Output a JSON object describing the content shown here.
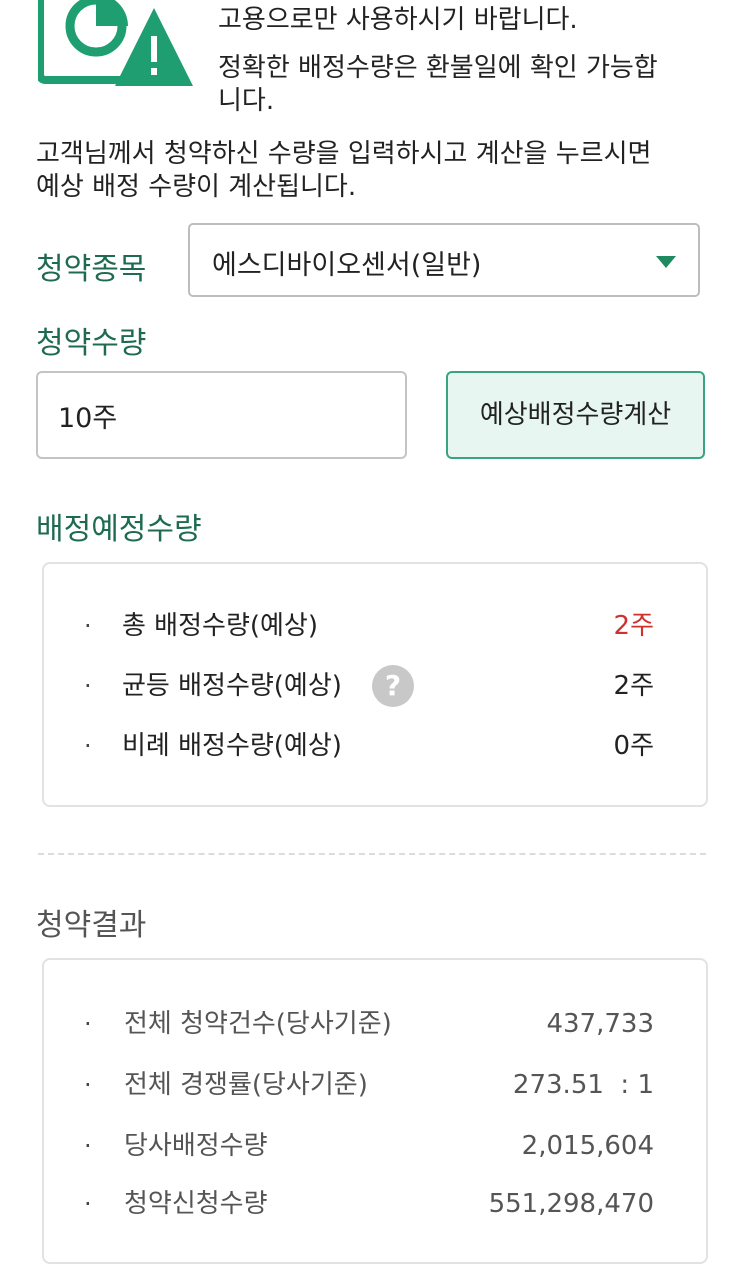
{
  "notice": {
    "lines": [
      "고용으로만 사용하시기 바랍니다.",
      "정확한 배정수량은 환불일에 확인 가능합",
      "니다."
    ]
  },
  "intro": {
    "lines": [
      "고객님께서 청약하신 수량을 입력하시고 계산을 누르시면",
      "예상 배정 수량이 계산됩니다."
    ]
  },
  "form": {
    "stock_label": "청약종목",
    "stock_selected": "에스디바이오센서(일반)",
    "qty_label": "청약수량",
    "qty_value": "10주",
    "calc_button": "예상배정수량계산"
  },
  "allocation": {
    "title": "배정예정수량",
    "rows": [
      {
        "label": "총 배정수량(예상)",
        "value": "2주"
      },
      {
        "label": "균등 배정수량(예상)",
        "value": "2주"
      },
      {
        "label": "비례 배정수량(예상)",
        "value": "0주"
      }
    ],
    "help_icon": "?"
  },
  "result": {
    "title": "청약결과",
    "rows": [
      {
        "label": "전체 청약건수(당사기준)",
        "value": "437,733"
      },
      {
        "label": "전체 경쟁률(당사기준)",
        "value": "273.51  : 1"
      },
      {
        "label": "당사배정수량",
        "value": "2,015,604"
      },
      {
        "label": "청약신청수량",
        "value": "551,298,470"
      }
    ]
  },
  "colors": {
    "brand_green": "#1f6b52",
    "button_bg": "#e7f6f0",
    "highlight_red": "#d0312d"
  },
  "bullet": "·",
  "icons": [
    "chart-warning-icon",
    "dropdown-arrow-icon",
    "help-icon"
  ]
}
